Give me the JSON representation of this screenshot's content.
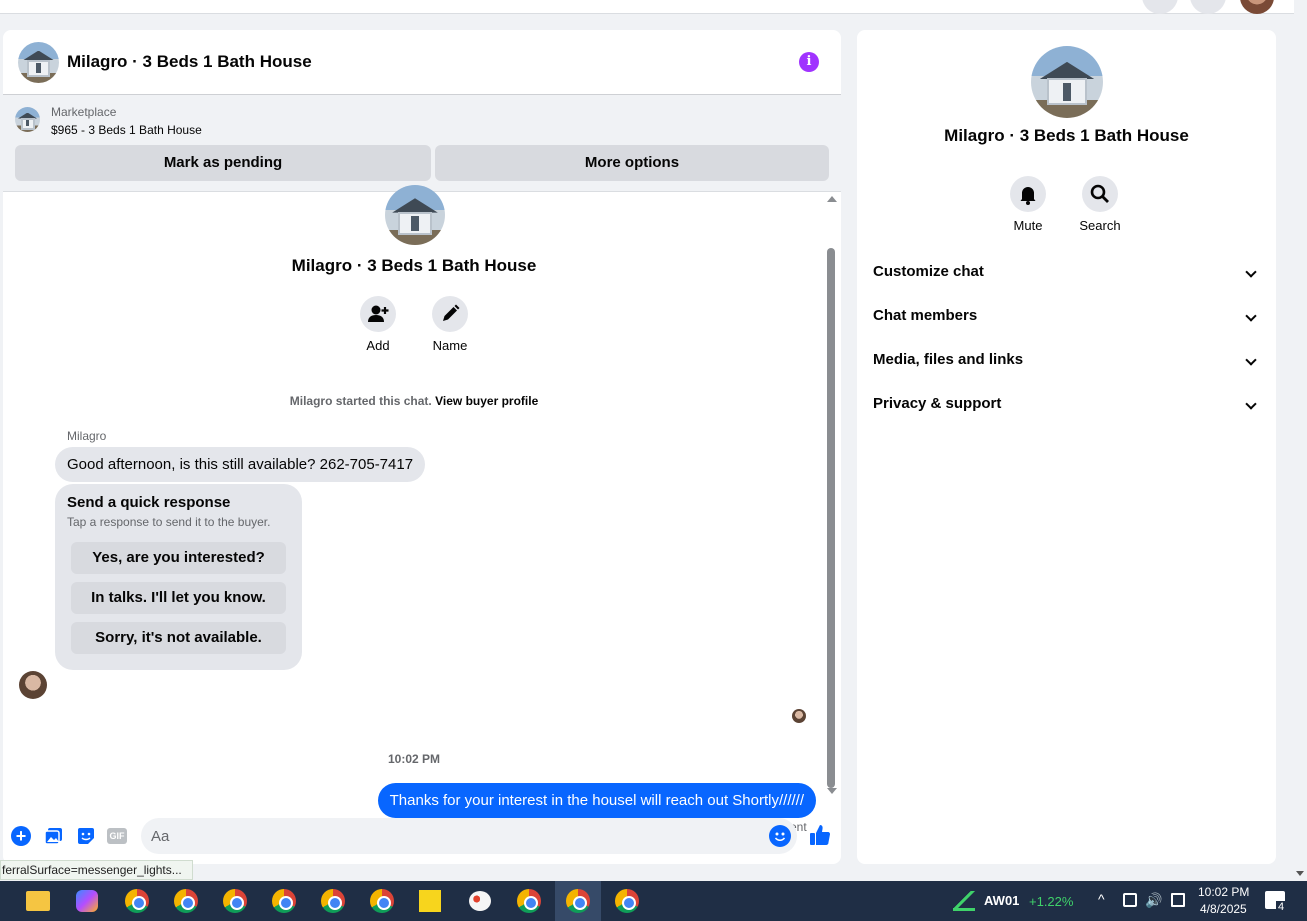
{
  "chat": {
    "title": "Milagro · 3 Beds 1 Bath House",
    "marketplace": {
      "label": "Marketplace",
      "price_line": "$965 - 3 Beds 1 Bath House",
      "mark_pending": "Mark as pending",
      "more_options": "More options"
    },
    "profile": {
      "title": "Milagro · 3 Beds 1 Bath House",
      "actions": [
        {
          "label": "Add"
        },
        {
          "label": "Name"
        }
      ]
    },
    "started_text": "Milagro started this chat.",
    "view_buyer": "View buyer profile",
    "sender_name": "Milagro",
    "incoming_message": "Good afternoon, is this still available? 262-705-7417",
    "quick_response": {
      "title": "Send a quick response",
      "subtitle": "Tap a response to send it to the buyer.",
      "options": [
        "Yes, are you interested?",
        "In talks. I'll let you know.",
        "Sorry, it's not available."
      ]
    },
    "timestamp": "10:02 PM",
    "outgoing_message": "Thanks for your interest in the housel will reach out Shortly//////",
    "sent_status": "Sent",
    "composer": {
      "placeholder": "Aa",
      "gif_label": "GIF"
    }
  },
  "info_panel": {
    "title": "Milagro · 3 Beds 1 Bath House",
    "actions": [
      {
        "label": "Mute",
        "icon": "bell-icon"
      },
      {
        "label": "Search",
        "icon": "search-icon"
      }
    ],
    "sections": [
      "Customize chat",
      "Chat members",
      "Media, files and links",
      "Privacy & support"
    ]
  },
  "status_hint": "ferralSurface=messenger_lights...",
  "taskbar": {
    "stock_ticker": "AW01",
    "stock_change": "+1.22%",
    "time": "10:02 PM",
    "date": "4/8/2025",
    "notification_count": "4"
  },
  "colors": {
    "accent": "#0866ff",
    "info_icon": "#a033ff",
    "bubble_in": "#e4e6eb"
  }
}
